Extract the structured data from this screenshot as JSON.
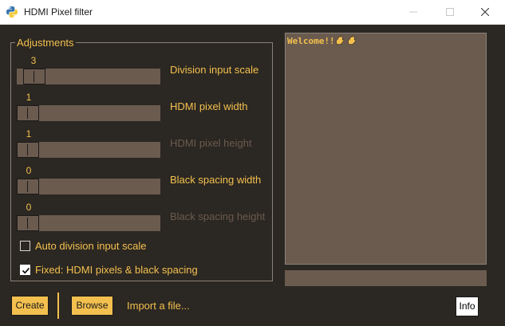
{
  "window": {
    "title": "HDMI Pixel filter",
    "icon": "python-icon",
    "controls": [
      "minimize-icon",
      "maximize-icon",
      "close-icon"
    ]
  },
  "adjustments": {
    "legend": "Adjustments",
    "sliders": [
      {
        "value": "3",
        "label": "Division input scale",
        "enabled": true
      },
      {
        "value": "1",
        "label": "HDMI pixel width",
        "enabled": true
      },
      {
        "value": "1",
        "label": "HDMI pixel height",
        "enabled": false
      },
      {
        "value": "0",
        "label": "Black spacing width",
        "enabled": true
      },
      {
        "value": "0",
        "label": "Black spacing height",
        "enabled": false
      }
    ],
    "checkboxes": [
      {
        "label": "Auto division input scale",
        "checked": false
      },
      {
        "label": "Fixed: HDMI pixels & black spacing",
        "checked": true
      }
    ]
  },
  "log": {
    "text": "Welcome!!",
    "emoji": "waving-hands-icon"
  },
  "entry": {
    "value": ""
  },
  "buttons": {
    "create": "Create",
    "browse": "Browse",
    "import": "Import a file...",
    "info": "Info"
  },
  "colors": {
    "accent": "#f3c04f",
    "background": "#2b2722",
    "panel": "#6b5b4f",
    "disabled_text": "#6b5b4f",
    "border": "#8a827a"
  }
}
